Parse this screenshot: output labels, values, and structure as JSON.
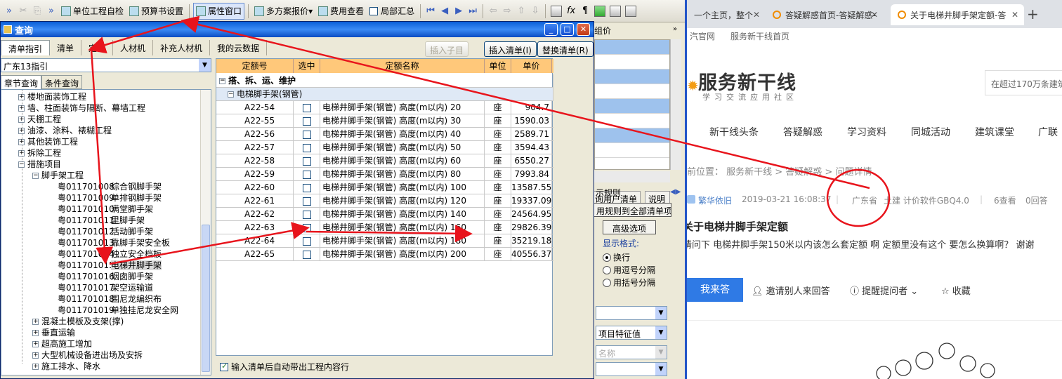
{
  "toolbar": {
    "items": [
      "单位工程自检",
      "预算书设置",
      "属性窗口",
      "多方案报价",
      "费用查看",
      "局部汇总"
    ],
    "right_glyphs": [
      "fx",
      "¶"
    ]
  },
  "bg_panel": {
    "zujia": "组价",
    "tab1": "询用户清单",
    "tab2": "说明",
    "rule_label": "示规则",
    "apply_btn": "用规则到全部清单项",
    "advanced_btn": "高级选项",
    "display_label": "显示格式:",
    "radios": [
      "换行",
      "用逗号分隔",
      "用括号分隔"
    ],
    "combo_a": "",
    "combo_b": "项目特征值",
    "combo_c": "名称",
    "combo_d": ""
  },
  "dialog": {
    "title": "查询",
    "tabs": [
      "清单指引",
      "清单",
      "定额",
      "人材机",
      "补充人材机",
      "我的云数据"
    ],
    "buttons": {
      "insert_child": "插入子目",
      "insert_list": "插入清单(I)",
      "replace_list": "替换清单(R)"
    },
    "region": "广东13指引",
    "subtabs": [
      "章节查询",
      "条件查询"
    ],
    "tree_top": [
      "楼地面装饰工程",
      "墙、柱面装饰与隔断、幕墙工程",
      "天棚工程",
      "油漆、涂料、裱糊工程",
      "其他装饰工程",
      "拆除工程",
      "措施项目"
    ],
    "scaffold": "脚手架工程",
    "tree_leaves": [
      {
        "code": "粤011701008",
        "name": "综合钢脚手架"
      },
      {
        "code": "粤011701009",
        "name": "单排钢脚手架"
      },
      {
        "code": "粤011701010",
        "name": "满堂脚手架"
      },
      {
        "code": "粤011701011",
        "name": "里脚手架"
      },
      {
        "code": "粤011701012",
        "name": "活动脚手架"
      },
      {
        "code": "粤011701013",
        "name": "靠脚手架安全板"
      },
      {
        "code": "粤011701014",
        "name": "独立安全档板"
      },
      {
        "code": "粤011701015",
        "name": "电梯井脚手架"
      },
      {
        "code": "粤011701016",
        "name": "烟囱脚手架"
      },
      {
        "code": "粤011701017",
        "name": "架空运输道"
      },
      {
        "code": "粤011701018",
        "name": "围尼龙编织布"
      },
      {
        "code": "粤011701019",
        "name": "单独挂尼龙安全网"
      }
    ],
    "tree_bottom": [
      "混凝土模板及支架(撑)",
      "垂直运输",
      "超高施工增加",
      "大型机械设备进出场及安拆",
      "施工排水、降水"
    ],
    "grid_headers": [
      "定额号",
      "选中",
      "定额名称",
      "单位",
      "单价"
    ],
    "group_row": "搭、拆、运、维护",
    "sub_group": "电梯脚手架(钢管)",
    "rows": [
      {
        "code": "A22-54",
        "name": "电梯井脚手架(钢管) 高度(m以内) 20",
        "unit": "座",
        "price": "904.7"
      },
      {
        "code": "A22-55",
        "name": "电梯井脚手架(钢管) 高度(m以内) 30",
        "unit": "座",
        "price": "1590.03"
      },
      {
        "code": "A22-56",
        "name": "电梯井脚手架(钢管) 高度(m以内) 40",
        "unit": "座",
        "price": "2589.71"
      },
      {
        "code": "A22-57",
        "name": "电梯井脚手架(钢管) 高度(m以内) 50",
        "unit": "座",
        "price": "3594.43"
      },
      {
        "code": "A22-58",
        "name": "电梯井脚手架(钢管) 高度(m以内) 60",
        "unit": "座",
        "price": "6550.27"
      },
      {
        "code": "A22-59",
        "name": "电梯井脚手架(钢管) 高度(m以内) 80",
        "unit": "座",
        "price": "7993.84"
      },
      {
        "code": "A22-60",
        "name": "电梯井脚手架(钢管) 高度(m以内) 100",
        "unit": "座",
        "price": "13587.55"
      },
      {
        "code": "A22-61",
        "name": "电梯井脚手架(钢管) 高度(m以内) 120",
        "unit": "座",
        "price": "19337.09"
      },
      {
        "code": "A22-62",
        "name": "电梯井脚手架(钢管) 高度(m以内) 140",
        "unit": "座",
        "price": "24564.95"
      },
      {
        "code": "A22-63",
        "name": "电梯井脚手架(钢管) 高度(m以内) 160",
        "unit": "座",
        "price": "29826.39"
      },
      {
        "code": "A22-64",
        "name": "电梯井脚手架(钢管) 高度(m以内) 180",
        "unit": "座",
        "price": "35219.18"
      },
      {
        "code": "A22-65",
        "name": "电梯井脚手架(钢管) 高度(m以内) 200",
        "unit": "座",
        "price": "40556.37"
      }
    ],
    "auto_check_label": "输入清单后自动带出工程内容行"
  },
  "browser": {
    "tabs": [
      "一个主页，整个",
      "答疑解惑首页-答疑解惑-",
      "关于电梯井脚手架定额-答"
    ],
    "bookmarks": [
      "汽官网",
      "服务新干线首页"
    ],
    "logo_name": "服务新干线",
    "slogan": "学习交流应用社区",
    "search_placeholder": "在超过170万条建筑",
    "nav": [
      "新干线头条",
      "答疑解惑",
      "学习资料",
      "同城活动",
      "建筑课堂",
      "广联"
    ],
    "breadcrumb": "前位置： 服务新干线 > 答疑解惑 > 问题详情",
    "user": "繁华依旧",
    "date": "2019-03-21 16:08:37",
    "region": "广东省",
    "category": "土建 计价软件GBQ4.0",
    "views": "6查看",
    "answers": "0回答",
    "question_title": "关于电梯井脚手架定额",
    "question_body": "请问下 电梯井脚手架150米以内该怎么套定额 啊  定额里没有这个  要怎么换算啊？ 谢谢",
    "answer_btn": "我来答",
    "invite": "邀请别人来回答",
    "remind": "提醒提问者",
    "collect": "收藏"
  },
  "colors": {
    "annotation": "#e8141c",
    "accent": "#2f7ae5",
    "title_bar": "#0a5fd8",
    "grid_header": "#ffc87a"
  }
}
